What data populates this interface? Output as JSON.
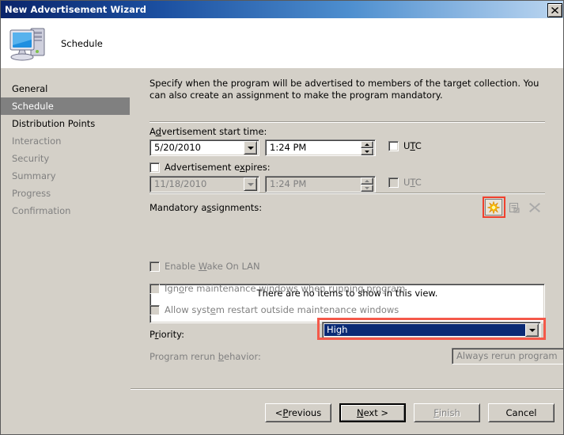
{
  "window": {
    "title": "New Advertisement Wizard",
    "close_label": "✕",
    "close_icon": "close-icon"
  },
  "header": {
    "title": "Schedule",
    "icon": "computer-icon"
  },
  "sidebar": {
    "items": [
      {
        "label": "General",
        "state": "enabled"
      },
      {
        "label": "Schedule",
        "state": "selected"
      },
      {
        "label": "Distribution Points",
        "state": "enabled"
      },
      {
        "label": "Interaction",
        "state": "disabled"
      },
      {
        "label": "Security",
        "state": "disabled"
      },
      {
        "label": "Summary",
        "state": "disabled"
      },
      {
        "label": "Progress",
        "state": "disabled"
      },
      {
        "label": "Confirmation",
        "state": "disabled"
      }
    ]
  },
  "main": {
    "intro": "Specify when the program will be advertised to members of the target collection. You can also create an assignment to make the program mandatory.",
    "start_time": {
      "label_pre": "A",
      "label_accel": "d",
      "label_post": "vertisement start time:",
      "date_value": "5/20/2010",
      "time_value": "1:24 PM",
      "utc_pre": "U",
      "utc_accel": "T",
      "utc_post": "C"
    },
    "expires": {
      "label_pre": "Advertisement e",
      "label_accel": "x",
      "label_post": "pires:",
      "checked": false,
      "date_value": "11/18/2010",
      "time_value": "1:24 PM",
      "utc_pre": "U",
      "utc_accel": "T",
      "utc_post": "C"
    },
    "mandatory": {
      "label_pre": "Mandatory a",
      "label_accel": "s",
      "label_post": "signments:",
      "empty_text": "There are no items to show in this view.",
      "buttons": [
        {
          "name": "new-assignment-button",
          "icon": "starburst-icon",
          "state": "enabled"
        },
        {
          "name": "properties-button",
          "icon": "properties-icon",
          "state": "disabled"
        },
        {
          "name": "delete-button",
          "icon": "x-delete-icon",
          "state": "disabled"
        }
      ],
      "highlight_color": "#f0402d"
    },
    "checkboxes": [
      {
        "name": "enable-wake-on-lan",
        "label_pre": "Enable ",
        "label_accel": "W",
        "label_post": "ake On LAN",
        "checked": false,
        "state": "disabled"
      },
      {
        "name": "ignore-maintenance-windows",
        "label_pre": "Ign",
        "label_accel": "o",
        "label_post": "re maintenance windows when running program",
        "checked": false,
        "state": "disabled"
      },
      {
        "name": "allow-system-restart",
        "label_pre": "Allow syst",
        "label_accel": "e",
        "label_post": "m restart outside maintenance windows",
        "checked": false,
        "state": "disabled"
      }
    ],
    "priority": {
      "label_pre": "P",
      "label_accel": "r",
      "label_post": "iority:",
      "value": "High",
      "state": "enabled",
      "selection_color": "#0a2a74",
      "highlight_color": "#f4594a"
    },
    "rerun": {
      "label_pre": "Program rerun ",
      "label_accel": "b",
      "label_post": "ehavior:",
      "value": "Always rerun program",
      "state": "disabled"
    }
  },
  "buttons": {
    "previous": {
      "pre": "< ",
      "accel": "P",
      "post": "revious",
      "state": "enabled"
    },
    "next": {
      "pre": "",
      "accel": "N",
      "post": "ext >",
      "state": "default"
    },
    "finish": {
      "pre": "",
      "accel": "F",
      "post": "inish",
      "state": "disabled"
    },
    "cancel": {
      "pre": "Cancel",
      "accel": "",
      "post": "",
      "state": "enabled"
    }
  }
}
